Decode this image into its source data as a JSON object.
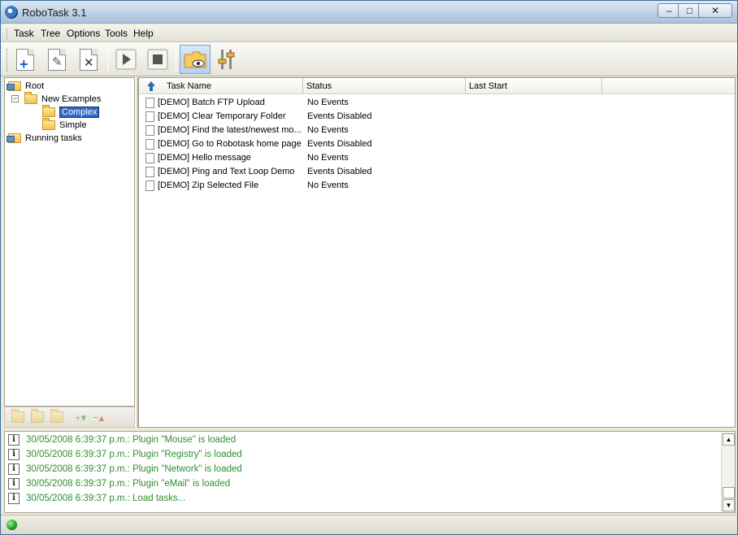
{
  "window": {
    "title": "RoboTask 3.1",
    "buttons": {
      "minimize": "–",
      "maximize": "□",
      "close": "✕"
    }
  },
  "menu": {
    "items": [
      {
        "label": "Task"
      },
      {
        "label": "Tree"
      },
      {
        "label": "Options"
      },
      {
        "label": "Tools"
      },
      {
        "label": "Help"
      }
    ]
  },
  "toolbar": {
    "tools": [
      {
        "name": "new-task",
        "icon": "document-plus-icon"
      },
      {
        "name": "edit-task",
        "icon": "document-pencil-icon"
      },
      {
        "name": "delete-task",
        "icon": "document-x-icon"
      },
      {
        "name": "run-task",
        "icon": "play-icon"
      },
      {
        "name": "stop-task",
        "icon": "stop-icon"
      },
      {
        "name": "watch-folder",
        "icon": "folder-eye-icon",
        "active": true
      },
      {
        "name": "settings",
        "icon": "sliders-icon"
      }
    ]
  },
  "tree": {
    "items": [
      {
        "label": "Root",
        "level": 0
      },
      {
        "label": "New Examples",
        "level": 1,
        "expanded": true
      },
      {
        "label": "Complex",
        "level": 2,
        "selected": true
      },
      {
        "label": "Simple",
        "level": 2
      },
      {
        "label": "Running tasks",
        "level": 0
      }
    ]
  },
  "task_list": {
    "columns": [
      "Task Name",
      "Status",
      "Last Start"
    ],
    "rows": [
      {
        "name": "[DEMO] Batch FTP Upload",
        "status": "No Events",
        "last_start": ""
      },
      {
        "name": "[DEMO] Clear Temporary Folder",
        "status": "Events Disabled",
        "last_start": ""
      },
      {
        "name": "[DEMO] Find the latest/newest mo...",
        "status": "No Events",
        "last_start": ""
      },
      {
        "name": "[DEMO] Go to Robotask home page",
        "status": "Events Disabled",
        "last_start": ""
      },
      {
        "name": "[DEMO] Hello message",
        "status": "No Events",
        "last_start": ""
      },
      {
        "name": "[DEMO] Ping and Text Loop Demo",
        "status": "Events Disabled",
        "last_start": ""
      },
      {
        "name": "[DEMO] Zip Selected File",
        "status": "No Events",
        "last_start": ""
      }
    ]
  },
  "log": {
    "entries": [
      "30/05/2008 6:39:37 p.m.: Plugin \"Mouse\" is loaded",
      "30/05/2008 6:39:37 p.m.: Plugin \"Registry\" is loaded",
      "30/05/2008 6:39:37 p.m.: Plugin \"Network\" is loaded",
      "30/05/2008 6:39:37 p.m.: Plugin \"eMail\" is loaded",
      "30/05/2008 6:39:37 p.m.: Load tasks..."
    ]
  },
  "colors": {
    "log_text": "#2f8f2f",
    "selection": "#3169c6",
    "status_led": "#1e9a1e"
  }
}
